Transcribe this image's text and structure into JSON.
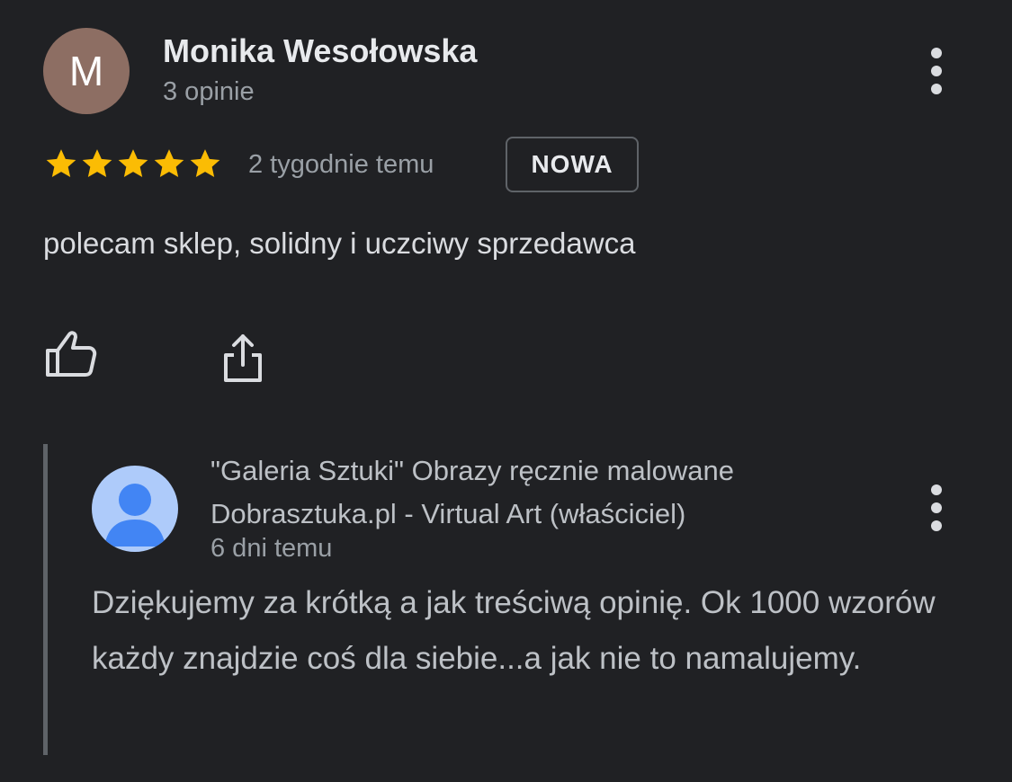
{
  "review": {
    "avatar_initial": "M",
    "reviewer_name": "Monika Wesołowska",
    "reviewer_reviews": "3 opinie",
    "rating": 5,
    "rating_max": 5,
    "star_color": "#fbbc04",
    "time": "2 tygodnie temu",
    "badge": "NOWA",
    "text": "polecam sklep, solidny i uczciwy sprzedawca",
    "menu_icon": "more-vert-icon",
    "actions": {
      "like_icon": "thumb-up-icon",
      "share_icon": "share-icon"
    }
  },
  "reply": {
    "owner_name": "\"Galeria Sztuki\" Obrazy ręcznie malowane Dobrasztuka.pl - Virtual Art (właściciel)",
    "time": "6 dni temu",
    "text": "Dziękujemy za krótką a jak treściwą opinię. Ok 1000 wzorów każdy znajdzie coś dla siebie...a jak nie to namalujemy.",
    "avatar_icon": "default-person-avatar-icon",
    "menu_icon": "more-vert-icon"
  },
  "colors": {
    "background": "#202124",
    "avatar_bg": "#8d6e63",
    "owner_avatar_bg": "#aecbfa",
    "owner_avatar_fg": "#4285f4"
  }
}
